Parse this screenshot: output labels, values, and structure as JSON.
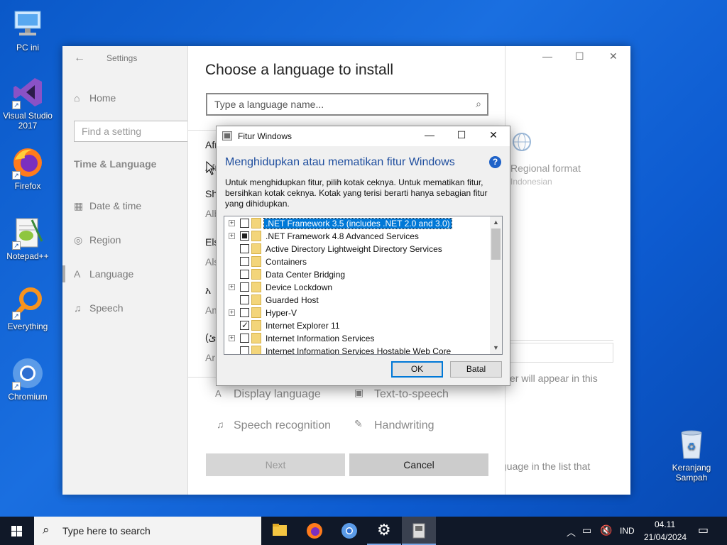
{
  "desktop": {
    "icons": [
      {
        "label": "PC ini",
        "icon": "pc-icon"
      },
      {
        "label": "Visual Studio 2017",
        "icon": "visual-studio-icon"
      },
      {
        "label": "Firefox",
        "icon": "firefox-icon"
      },
      {
        "label": "Notepad++",
        "icon": "notepadpp-icon"
      },
      {
        "label": "Everything",
        "icon": "everything-icon"
      },
      {
        "label": "Chromium",
        "icon": "chromium-icon"
      },
      {
        "label": "Keranjang Sampah",
        "icon": "recycle-bin-icon"
      }
    ]
  },
  "settings": {
    "title": "Settings",
    "nav": {
      "home": "Home",
      "find_placeholder": "Find a setting",
      "section": "Time & Language",
      "items": [
        "Date & time",
        "Region",
        "Language",
        "Speech"
      ]
    },
    "choose": {
      "heading": "Choose a language to install",
      "search_placeholder": "Type a language name...",
      "rows": [
        {
          "name": "Afr",
          "sub": "Afr"
        },
        {
          "name": "Sh",
          "sub": "Alb"
        },
        {
          "name": "Els",
          "sub": "Als"
        },
        {
          "name": "አ",
          "sub": "Am"
        },
        {
          "name": "(ئ",
          "sub": "Ar"
        }
      ],
      "features": [
        "Display language",
        "Text-to-speech",
        "Speech recognition",
        "Handwriting"
      ],
      "next_label": "Next",
      "cancel_label": "Cancel"
    },
    "right": {
      "regional_format": "Regional format",
      "regional_sub": "Indonesian",
      "will_appear": "er will appear in this",
      "guage_list": "guage in the list that"
    },
    "window_controls": [
      "—",
      "☐",
      "✕"
    ]
  },
  "dialog": {
    "title": "Fitur Windows",
    "heading": "Menghidupkan atau mematikan fitur Windows",
    "description": "Untuk menghidupkan fitur, pilih kotak ceknya. Untuk mematikan fitur, bersihkan kotak ceknya. Kotak yang terisi berarti hanya sebagian fitur yang dihidupkan.",
    "help": "?",
    "features": [
      {
        "label": ".NET Framework 3.5 (includes .NET 2.0 and 3.0)",
        "expandable": true,
        "state": "unchecked",
        "selected": true
      },
      {
        "label": ".NET Framework 4.8 Advanced Services",
        "expandable": true,
        "state": "partial",
        "selected": false
      },
      {
        "label": "Active Directory Lightweight Directory Services",
        "expandable": false,
        "state": "unchecked",
        "selected": false
      },
      {
        "label": "Containers",
        "expandable": false,
        "state": "unchecked",
        "selected": false
      },
      {
        "label": "Data Center Bridging",
        "expandable": false,
        "state": "unchecked",
        "selected": false
      },
      {
        "label": "Device Lockdown",
        "expandable": true,
        "state": "unchecked",
        "selected": false
      },
      {
        "label": "Guarded Host",
        "expandable": false,
        "state": "unchecked",
        "selected": false
      },
      {
        "label": "Hyper-V",
        "expandable": true,
        "state": "unchecked",
        "selected": false
      },
      {
        "label": "Internet Explorer 11",
        "expandable": false,
        "state": "checked",
        "selected": false
      },
      {
        "label": "Internet Information Services",
        "expandable": true,
        "state": "unchecked",
        "selected": false
      },
      {
        "label": "Internet Information Services Hostable Web Core",
        "expandable": false,
        "state": "unchecked",
        "selected": false
      }
    ],
    "ok_label": "OK",
    "cancel_label": "Batal"
  },
  "taskbar": {
    "search_placeholder": "Type here to search",
    "apps": [
      "file-explorer-icon",
      "firefox-icon",
      "chromium-icon",
      "settings-gear-icon",
      "fitur-windows-icon"
    ],
    "language": "IND",
    "time": "04.11",
    "date": "21/04/2024"
  }
}
